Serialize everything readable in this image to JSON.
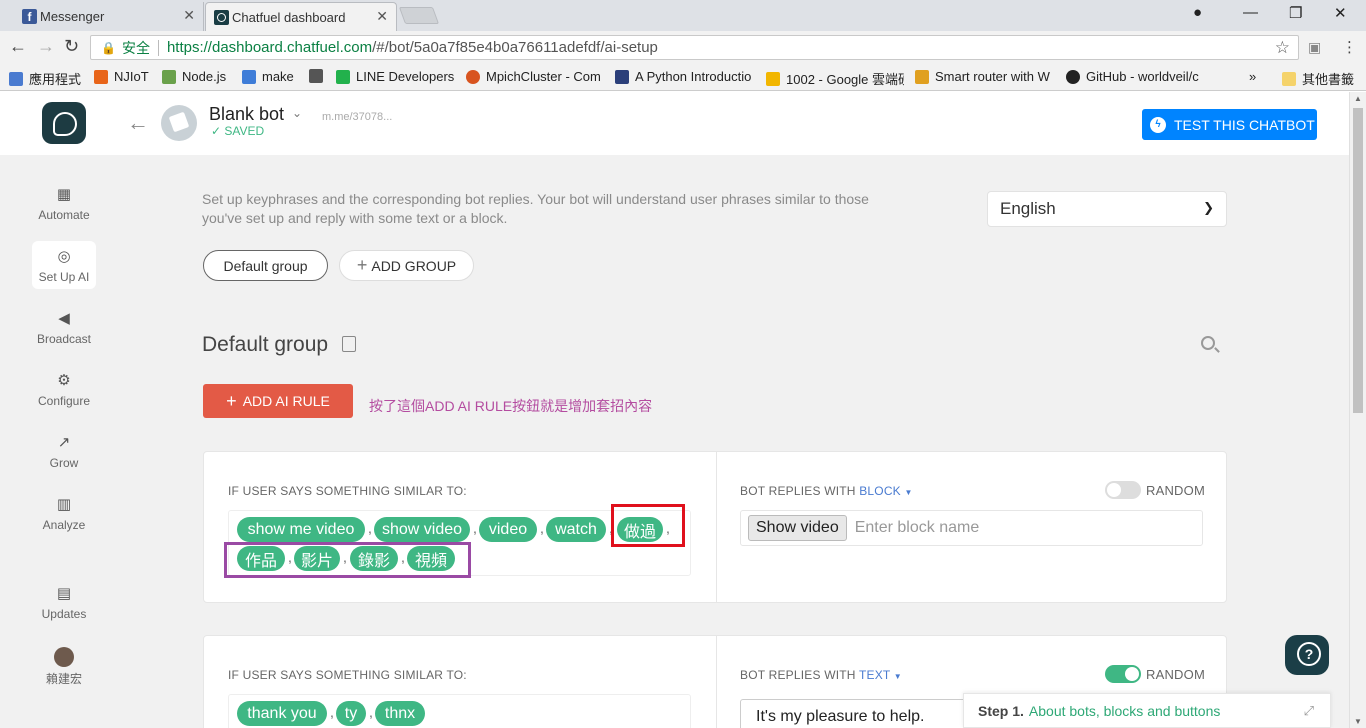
{
  "browser": {
    "tabs": [
      {
        "title": "Messenger",
        "icon": "facebook-icon"
      },
      {
        "title": "Chatfuel dashboard",
        "icon": "chatfuel-icon"
      }
    ],
    "secure_label": "安全",
    "url_host": "https://dashboard.chatfuel.com",
    "url_path": "/#/bot/5a0a7f85e4b0a76611adefdf/ai-setup",
    "bookmarks": [
      {
        "label": "應用程式",
        "color": "#4a7bd0"
      },
      {
        "label": "NJIoT",
        "color": "#e8651a"
      },
      {
        "label": "Node.js",
        "color": "#6aa14b"
      },
      {
        "label": "make",
        "color": "#3f7dd8"
      },
      {
        "label": "",
        "color": "#555555"
      },
      {
        "label": "LINE Developers",
        "color": "#22b14c"
      },
      {
        "label": "MpichCluster - Com",
        "color": "#d8541f"
      },
      {
        "label": "A Python Introductio",
        "color": "#2b3f7a"
      },
      {
        "label": "1002 - Google 雲端硬",
        "color": "#f2b600"
      },
      {
        "label": "Smart router with W",
        "color": "#e0a020"
      },
      {
        "label": "GitHub - worldveil/c",
        "color": "#222222"
      }
    ],
    "bookmarks_more": "»",
    "other_bookmarks": "其他書籤"
  },
  "header": {
    "bot_name": "Blank bot",
    "saved": "SAVED",
    "mme_link": "m.me/37078...",
    "test_button": "TEST THIS CHATBOT"
  },
  "sidebar": {
    "items": [
      {
        "label": "Automate",
        "icon": "automate-icon"
      },
      {
        "label": "Set Up AI",
        "icon": "ai-icon"
      },
      {
        "label": "Broadcast",
        "icon": "megaphone-icon"
      },
      {
        "label": "Configure",
        "icon": "gear-icon"
      },
      {
        "label": "Grow",
        "icon": "grow-icon"
      },
      {
        "label": "Analyze",
        "icon": "chart-icon"
      },
      {
        "label": "Updates",
        "icon": "updates-icon"
      },
      {
        "label": "賴建宏",
        "icon": "avatar"
      }
    ]
  },
  "main": {
    "intro_line1": "Set up keyphrases and the corresponding bot replies. Your bot will understand user phrases similar to those",
    "intro_line2": "you've set up and reply with some text or a block.",
    "language": "English",
    "group_pill": "Default group",
    "add_group": "ADD GROUP",
    "group_title": "Default group",
    "add_ai_rule": "ADD AI RULE",
    "annotation": "按了這個ADD AI RULE按鈕就是增加套招內容"
  },
  "rules": [
    {
      "if_label": "IF USER SAYS SOMETHING SIMILAR TO:",
      "phrases": [
        "show me video",
        "show video",
        "video",
        "watch",
        "做過",
        "作品",
        "影片",
        "錄影",
        "視頻"
      ],
      "reply_prefix": "BOT REPLIES WITH ",
      "reply_type": "BLOCK",
      "random_label": "RANDOM",
      "random_on": false,
      "block_chip": "Show video",
      "block_placeholder": "Enter block name"
    },
    {
      "if_label": "IF USER SAYS SOMETHING SIMILAR TO:",
      "phrases": [
        "thank you",
        "ty",
        "thnx"
      ],
      "reply_prefix": "BOT REPLIES WITH ",
      "reply_type": "TEXT",
      "random_label": "RANDOM",
      "random_on": true,
      "text_reply": "It's my pleasure to help."
    }
  ],
  "onboarding": {
    "step": "Step 1.",
    "link": "About bots, blocks and buttons"
  },
  "colors": {
    "accent_green": "#3fb784",
    "messenger_blue": "#0084ff",
    "add_rule_red": "#e35a46",
    "annotation_red_box": "#e0101c",
    "annotation_purple_box": "#9a4aa4",
    "annotation_text": "#b44ca0"
  }
}
